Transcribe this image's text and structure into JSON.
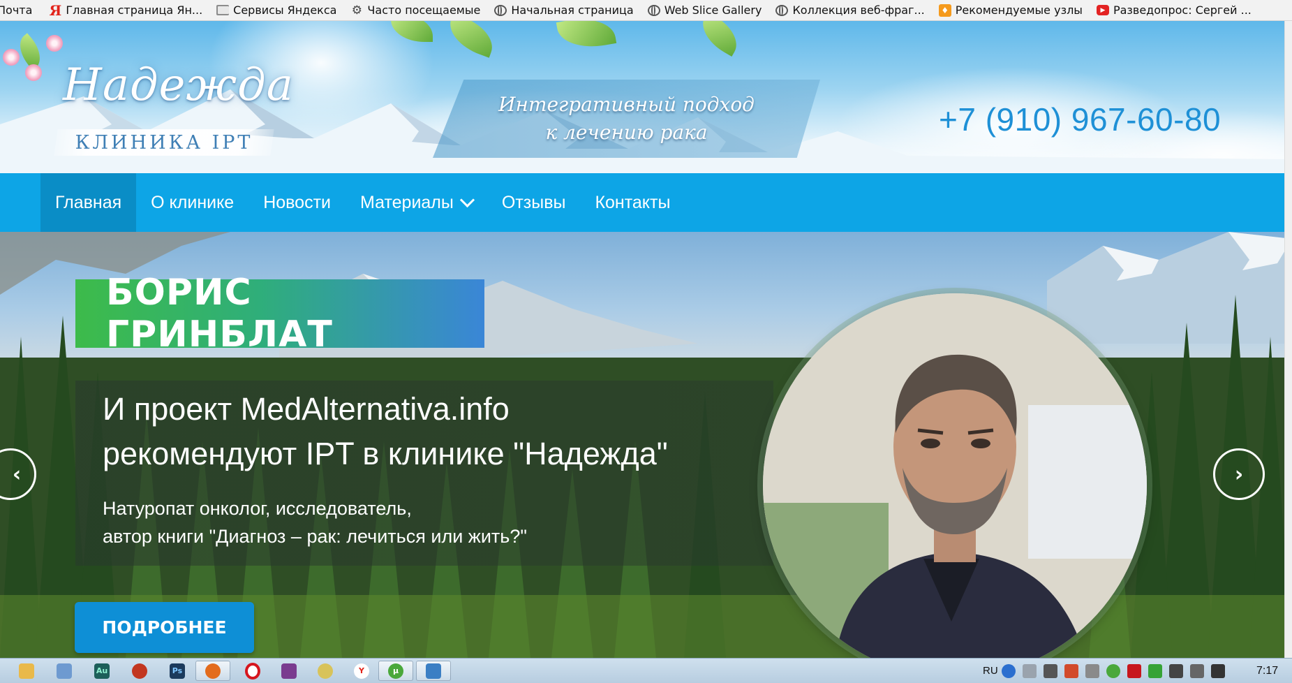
{
  "bookmarks": [
    {
      "label": "Почта",
      "icon": "none"
    },
    {
      "label": "Главная страница Ян...",
      "icon": "yandex-icon"
    },
    {
      "label": "Сервисы Яндекса",
      "icon": "folder-icon"
    },
    {
      "label": "Часто посещаемые",
      "icon": "gear-icon"
    },
    {
      "label": "Начальная страница",
      "icon": "globe-icon"
    },
    {
      "label": "Web Slice Gallery",
      "icon": "globe-icon"
    },
    {
      "label": "Коллекция веб-фраг...",
      "icon": "globe-icon"
    },
    {
      "label": "Рекомендуемые узлы",
      "icon": "feed-icon"
    },
    {
      "label": "Разведопрос: Сергей ...",
      "icon": "youtube-icon"
    }
  ],
  "header": {
    "logo_name": "Надежда",
    "logo_sub": "КЛИНИКА IPT",
    "tagline_line1": "Интегративный подход",
    "tagline_line2": "к лечению рака",
    "phone": "+7 (910) 967-60-80"
  },
  "nav": {
    "items": [
      "Главная",
      "О клинике",
      "Новости",
      "Материалы",
      "Отзывы",
      "Контакты"
    ],
    "active_index": 0
  },
  "slide": {
    "name": "БОРИС ГРИНБЛАТ",
    "headline_line1": "И проект MedAlternativa.info",
    "headline_line2": "рекомендуют IPT в клинике \"Надежда\"",
    "sub_line1": "Натуропат онколог, исследователь,",
    "sub_line2": "автор книги \"Диагноз – рак: лечиться или жить?\"",
    "button_label": "ПОДРОБНЕЕ",
    "prev_arrow": "‹",
    "next_arrow": "›"
  },
  "taskbar": {
    "apps": [
      "file-explorer",
      "paint",
      "audition",
      "media-player",
      "photoshop",
      "firefox",
      "opera",
      "winrar",
      "media-player-classic",
      "yandex-browser",
      "utorrent",
      "connection"
    ],
    "language": "RU",
    "time": "7:17"
  },
  "colors": {
    "nav_bg": "#0da5e6",
    "nav_active_bg": "#0a8dc6",
    "phone": "#1e90d6",
    "button_bg": "#0e8fd6"
  }
}
